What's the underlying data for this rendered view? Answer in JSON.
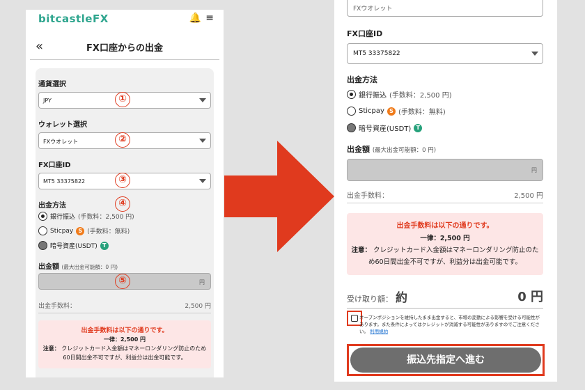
{
  "left": {
    "logo": "bitcastleFX",
    "title": "FX口座からの出金",
    "currency_label": "通貨選択",
    "currency_value": "JPY",
    "wallet_label": "ウォレット選択",
    "wallet_value": "FXウオレット",
    "account_label": "FX口座ID",
    "account_value": "MT5 33375822",
    "method_label": "出金方法",
    "method_bank": "銀行振込",
    "method_bank_fee": "(手数料：2,500 円)",
    "method_sticpay": "Sticpay",
    "method_sticpay_fee": "(手数料：無料)",
    "method_crypto": "暗号資産(USDT)",
    "amount_label": "出金額",
    "amount_sub": "(最大出金可能額：0 円)",
    "amount_unit": "円",
    "fee_label": "出金手数料：",
    "fee_value": "2,500 円",
    "notice_title": "出金手数料は以下の通りです。",
    "notice_once": "一律：2,500 円",
    "notice_note_bold": "注意：",
    "notice_note": "クレジットカード入金額はマネーロンダリング防止のため60日間出金不可ですが、利益分は出金可能です。",
    "n1": "①",
    "n2": "②",
    "n3": "③",
    "n4": "④",
    "n5": "⑤"
  },
  "right": {
    "top_partial": "FXウオレット",
    "account_label": "FX口座ID",
    "account_value": "MT5 33375822",
    "method_label": "出金方法",
    "method_bank": "銀行振込",
    "method_bank_fee": "(手数料：2,500 円)",
    "method_sticpay": "Sticpay",
    "method_sticpay_fee": "(手数料：無料)",
    "method_crypto": "暗号資産(USDT)",
    "amount_label": "出金額",
    "amount_sub": "(最大出金可能額：0 円)",
    "amount_unit": "円",
    "fee_label": "出金手数料：",
    "fee_value": "2,500 円",
    "notice_title": "出金手数料は以下の通りです。",
    "notice_once": "一律：2,500 円",
    "notice_note_bold": "注意：",
    "notice_note": "クレジットカード入金額はマネーロンダリング防止のため60日間出金不可ですが、利益分は出金可能です。",
    "receive_label": "受け取り額：",
    "receive_approx": "約",
    "receive_value": "0 円",
    "agree_text": "オープンポジションを維持したまま出金すると、市場の変動による影響を受ける可能性があります。また条件によってはクレジットが消滅する可能性がありますのでご注意ください。",
    "agree_link": "利用規約",
    "submit": "振込先指定へ進む"
  },
  "colors": {
    "accent": "#e03a1e",
    "brand": "#2ea58e",
    "sticpay": "#f07b1a",
    "tether": "#26a17b"
  }
}
